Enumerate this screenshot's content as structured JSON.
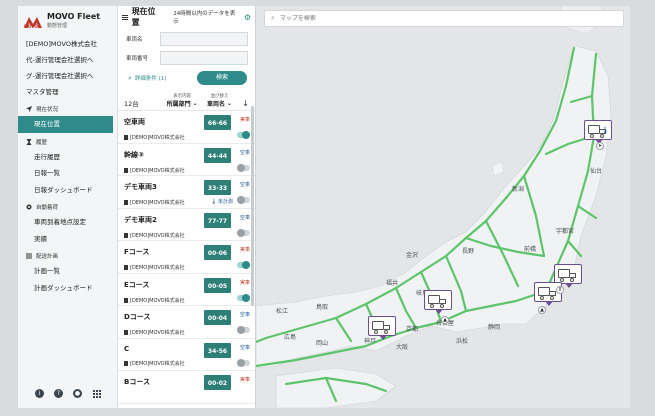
{
  "brand": {
    "title": "MOVO Fleet",
    "subtitle": "動態管理",
    "logo_word": "MOVO"
  },
  "sidebar": {
    "top_links": [
      "[DEMO]MOVO株式会社",
      "代-運行管理会社選択へ",
      "グ-運行管理会社選択へ",
      "マスタ管理"
    ],
    "sections": [
      {
        "label": "現在状況",
        "icon": "navigation-icon",
        "items": [
          {
            "label": "現在位置",
            "active": true
          }
        ]
      },
      {
        "label": "履歴",
        "icon": "hourglass-icon",
        "items": [
          {
            "label": "走行履歴"
          },
          {
            "label": "日報一覧"
          },
          {
            "label": "日報ダッシュボード"
          }
        ]
      },
      {
        "label": "自動着荷",
        "icon": "location-pin-icon",
        "items": [
          {
            "label": "車両到着地点設定"
          },
          {
            "label": "実績"
          }
        ]
      },
      {
        "label": "配送計画",
        "icon": "list-icon",
        "items": [
          {
            "label": "計画一覧"
          },
          {
            "label": "計画ダッシュボード"
          }
        ]
      }
    ],
    "footer_icons": [
      "info-icon",
      "help-icon",
      "user-icon",
      "apps-icon"
    ]
  },
  "panel": {
    "title": "現在位置",
    "note": "24時間以内のデータを表示",
    "fields": [
      {
        "label": "車両名",
        "value": ""
      },
      {
        "label": "車両番号",
        "value": ""
      }
    ],
    "advanced_link": "詳細条件 (1)",
    "search_button": "検索",
    "count": "12台",
    "col1_top": "表示内容",
    "col1_main": "所属部門",
    "col2_top": "並び替え",
    "col2_main": "車両名"
  },
  "vehicles": [
    {
      "name": "空車両",
      "company": "[DEMO]MOVO株式会社",
      "plate": "66-66",
      "status": "実車",
      "status_color": "red",
      "toggle": true,
      "temp": ""
    },
    {
      "name": "幹線③",
      "company": "[DEMO]MOVO株式会社",
      "plate": "44-44",
      "status": "空車",
      "status_color": "blue",
      "toggle": false,
      "temp": ""
    },
    {
      "name": "デモ車両3",
      "company": "[DEMO]MOVO株式会社",
      "plate": "33-33",
      "status": "空車",
      "status_color": "blue",
      "toggle": false,
      "temp": "未計測"
    },
    {
      "name": "デモ車両2",
      "company": "[DEMO]MOVO株式会社",
      "plate": "77-77",
      "status": "空車",
      "status_color": "blue",
      "toggle": false,
      "temp": ""
    },
    {
      "name": "Fコース",
      "company": "[DEMO]MOVO株式会社",
      "plate": "00-06",
      "status": "実車",
      "status_color": "red",
      "toggle": true,
      "temp": ""
    },
    {
      "name": "Eコース",
      "company": "[DEMO]MOVO株式会社",
      "plate": "00-05",
      "status": "実車",
      "status_color": "red",
      "toggle": true,
      "temp": ""
    },
    {
      "name": "Dコース",
      "company": "[DEMO]MOVO株式会社",
      "plate": "00-04",
      "status": "空車",
      "status_color": "blue",
      "toggle": false,
      "temp": ""
    },
    {
      "name": "C",
      "company": "[DEMO]MOVO株式会社",
      "plate": "34-56",
      "status": "空車",
      "status_color": "blue",
      "toggle": false,
      "temp": ""
    },
    {
      "name": "Bコース",
      "company": "",
      "plate": "00-02",
      "status": "実車",
      "status_color": "red",
      "toggle": false,
      "temp": ""
    }
  ],
  "map": {
    "search_placeholder": "マップを検索",
    "cities": [
      "新潟",
      "仙台",
      "静岡",
      "岐阜",
      "長野",
      "前橋",
      "宇都宮",
      "福井",
      "金沢",
      "名古屋",
      "神戸",
      "大阪",
      "京都",
      "広島",
      "岡山",
      "浜松",
      "松江",
      "鳥取"
    ]
  },
  "colors": {
    "accent": "#2e8b8a",
    "road": "#5cc46b",
    "land": "#e9eaeb",
    "sea": "#e4e5e6",
    "marker": "#6b4e92"
  }
}
